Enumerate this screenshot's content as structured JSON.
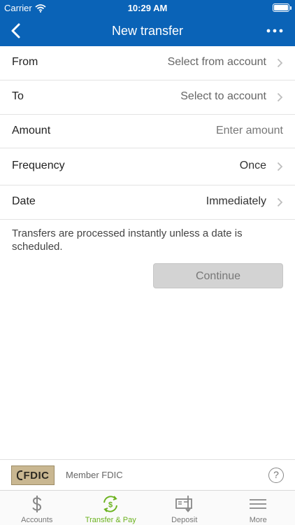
{
  "status": {
    "carrier": "Carrier",
    "time": "10:29 AM"
  },
  "nav": {
    "title": "New transfer",
    "back_icon": "chevron-left-icon",
    "more_icon": "ellipsis-icon"
  },
  "form": {
    "rows": [
      {
        "label": "From",
        "value": "Select from account"
      },
      {
        "label": "To",
        "value": "Select to account"
      },
      {
        "label": "Amount",
        "placeholder": "Enter amount"
      },
      {
        "label": "Frequency",
        "value": "Once"
      },
      {
        "label": "Date",
        "value": "Immediately"
      }
    ],
    "note": "Transfers are processed instantly unless a date is scheduled.",
    "continue_label": "Continue"
  },
  "footer": {
    "logo_text": "FDIC",
    "member_text": "Member FDIC",
    "help_text": "?"
  },
  "tabs": [
    {
      "label": "Accounts",
      "icon": "dollar-icon",
      "active": false
    },
    {
      "label": "Transfer & Pay",
      "icon": "transfer-pay-icon",
      "active": true
    },
    {
      "label": "Deposit",
      "icon": "check-deposit-icon",
      "active": false
    },
    {
      "label": "More",
      "icon": "menu-icon",
      "active": false
    }
  ],
  "colors": {
    "brand_blue": "#0a63b7",
    "active_green": "#6bb21e",
    "button_gray": "#d3d3d3"
  }
}
